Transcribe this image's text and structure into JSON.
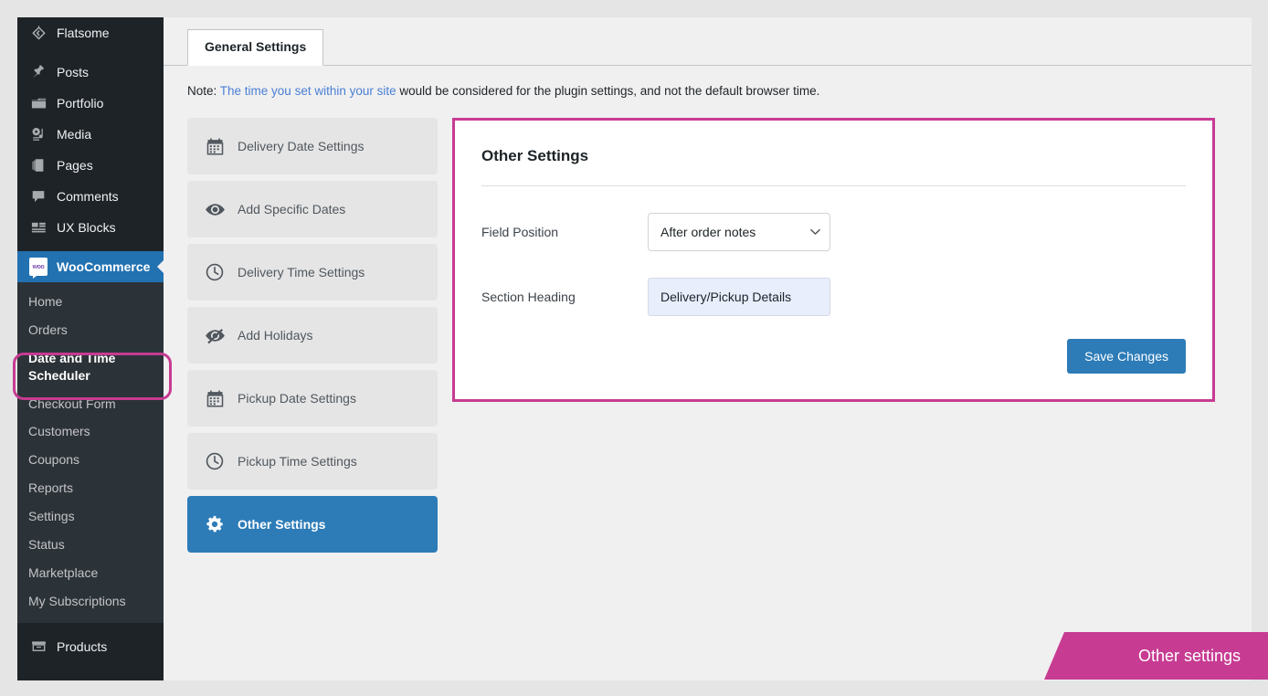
{
  "sidebar": {
    "items": [
      {
        "label": "Flatsome",
        "icon": "flatsome-diamond-icon",
        "state": "normal"
      },
      {
        "label": "Posts",
        "icon": "pin-icon",
        "state": "normal"
      },
      {
        "label": "Portfolio",
        "icon": "folder-icon",
        "state": "normal"
      },
      {
        "label": "Media",
        "icon": "media-icon",
        "state": "normal"
      },
      {
        "label": "Pages",
        "icon": "pages-icon",
        "state": "normal"
      },
      {
        "label": "Comments",
        "icon": "comment-icon",
        "state": "normal"
      },
      {
        "label": "UX Blocks",
        "icon": "blocks-icon",
        "state": "normal"
      },
      {
        "label": "WooCommerce",
        "icon": "woocommerce-icon",
        "state": "current"
      },
      {
        "label": "Products",
        "icon": "products-box-icon",
        "state": "normal"
      }
    ],
    "woo_badge_text": "woo",
    "submenu": [
      {
        "label": "Home",
        "current": false
      },
      {
        "label": "Orders",
        "current": false
      },
      {
        "label": "Date and Time Scheduler",
        "current": true
      },
      {
        "label": "Checkout Form",
        "current": false
      },
      {
        "label": "Customers",
        "current": false
      },
      {
        "label": "Coupons",
        "current": false
      },
      {
        "label": "Reports",
        "current": false
      },
      {
        "label": "Settings",
        "current": false
      },
      {
        "label": "Status",
        "current": false
      },
      {
        "label": "Marketplace",
        "current": false
      },
      {
        "label": "My Subscriptions",
        "current": false
      }
    ]
  },
  "tabs": [
    {
      "label": "General Settings",
      "active": true
    }
  ],
  "note": {
    "prefix": "Note: ",
    "link_text": "The time you set within your site",
    "suffix": " would be considered for the plugin settings, and not the default browser time."
  },
  "settings_nav": [
    {
      "label": "Delivery Date Settings",
      "icon": "calendar-icon",
      "active": false
    },
    {
      "label": "Add Specific Dates",
      "icon": "eye-icon",
      "active": false
    },
    {
      "label": "Delivery Time Settings",
      "icon": "clock-icon",
      "active": false
    },
    {
      "label": "Add Holidays",
      "icon": "eye-slash-icon",
      "active": false
    },
    {
      "label": "Pickup Date Settings",
      "icon": "calendar-icon",
      "active": false
    },
    {
      "label": "Pickup Time Settings",
      "icon": "clock-icon",
      "active": false
    },
    {
      "label": "Other Settings",
      "icon": "gear-icon",
      "active": true
    }
  ],
  "panel": {
    "title": "Other Settings",
    "fields": [
      {
        "label": "Field Position",
        "type": "select",
        "value": "After order notes",
        "options": [
          "After order notes"
        ]
      },
      {
        "label": "Section Heading",
        "type": "text",
        "value": "Delivery/Pickup Details",
        "placeholder": ""
      }
    ],
    "save_label": "Save Changes"
  },
  "callout": {
    "label": "Other settings"
  },
  "colors": {
    "accent_magenta": "#c73b92",
    "wp_blue": "#2271b1",
    "button_blue": "#2d7cb8",
    "sidebar_dark": "#1d2327",
    "submenu_dark": "#2c3338",
    "link_blue": "#4a7fd4",
    "input_fill": "#e8eefc"
  }
}
